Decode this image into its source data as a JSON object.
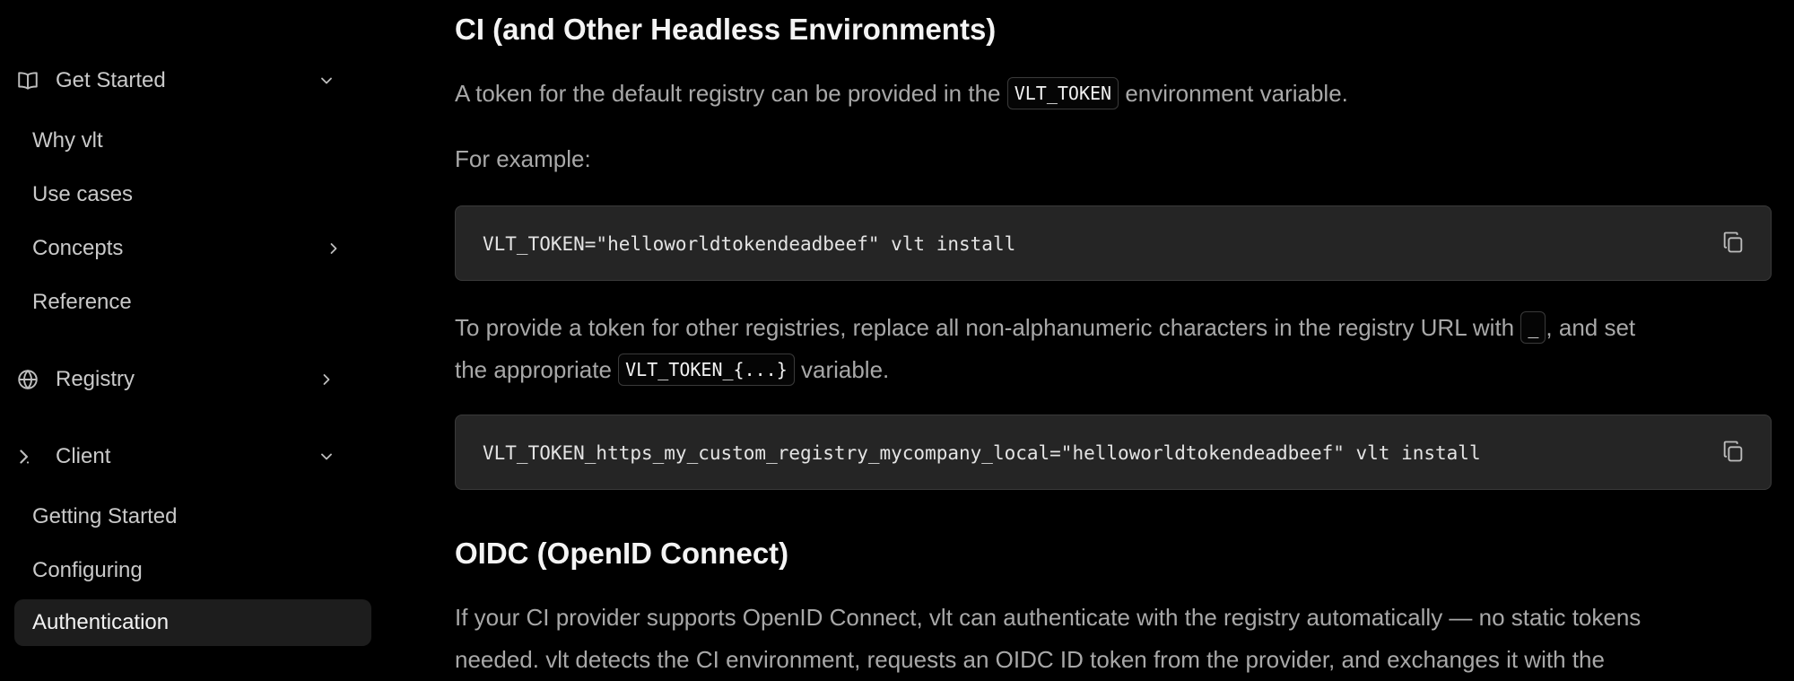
{
  "sidebar": {
    "groups": {
      "get_started": {
        "label": "Get Started",
        "icon": "book-icon",
        "expanded": true
      },
      "registry": {
        "label": "Registry",
        "icon": "globe-icon",
        "expanded": false
      },
      "client": {
        "label": "Client",
        "icon": "terminal-prompt-icon",
        "expanded": true
      }
    },
    "get_started_items": [
      "Why vlt",
      "Use cases",
      "Concepts",
      "Reference"
    ],
    "client_items": [
      "Getting Started",
      "Configuring",
      "Authentication"
    ],
    "active_item": "Authentication"
  },
  "content": {
    "heading_ci": "CI (and Other Headless Environments)",
    "p1_before": "A token for the default registry can be provided in the ",
    "p1_code": "VLT_TOKEN",
    "p1_after": " environment variable.",
    "p2": "For example:",
    "code1": "VLT_TOKEN=\"helloworldtokendeadbeef\" vlt install",
    "p3_line1_before": "To provide a token for other registries, replace all non-alphanumeric characters in the registry URL with ",
    "p3_code1": "_",
    "p3_line1_after": ", and set",
    "p3_line2_before": "the appropriate ",
    "p3_code2": "VLT_TOKEN_{...}",
    "p3_line2_after": " variable.",
    "code2": "VLT_TOKEN_https_my_custom_registry_mycompany_local=\"helloworldtokendeadbeef\" vlt install",
    "heading_oidc": "OIDC (OpenID Connect)",
    "p4_line1": "If your CI provider supports OpenID Connect, vlt can authenticate with the registry automatically — no static tokens",
    "p4_line2": "needed. vlt detects the CI environment, requests an OIDC ID token from the provider, and exchanges it with the"
  },
  "colors": {
    "background": "#000000",
    "sidebar_active_bg": "#1d1d1d",
    "code_block_bg": "#252525",
    "heading": "#f4f4f4",
    "body_text": "#a8a8a8"
  }
}
